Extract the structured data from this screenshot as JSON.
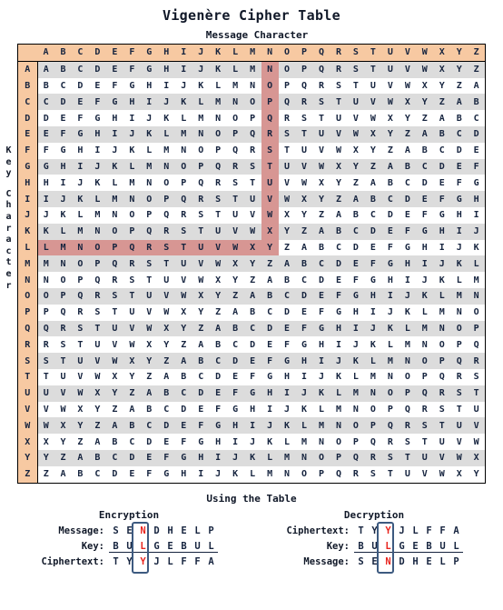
{
  "title": "Vigenère Cipher Table",
  "labels": {
    "message_character": "Message Character",
    "key_character": "Key Character",
    "using_the_table": "Using the Table"
  },
  "colors": {
    "header_peach": "#f7c9a2",
    "highlight_salmon": "#d79693",
    "stripe_gray": "#dcdcdc",
    "stripe_white": "#ffffff",
    "mark_red": "#e8251f",
    "box_blue": "#3d5a80",
    "text_navy": "#16243f"
  },
  "table": {
    "alphabet": [
      "A",
      "B",
      "C",
      "D",
      "E",
      "F",
      "G",
      "H",
      "I",
      "J",
      "K",
      "L",
      "M",
      "N",
      "O",
      "P",
      "Q",
      "R",
      "S",
      "T",
      "U",
      "V",
      "W",
      "X",
      "Y",
      "Z"
    ],
    "highlight_row": "L",
    "highlight_col": "N",
    "intersection_value": "Y",
    "rows": [
      {
        "key": "A",
        "cells": [
          "A",
          "B",
          "C",
          "D",
          "E",
          "F",
          "G",
          "H",
          "I",
          "J",
          "K",
          "L",
          "M",
          "N",
          "O",
          "P",
          "Q",
          "R",
          "S",
          "T",
          "U",
          "V",
          "W",
          "X",
          "Y",
          "Z"
        ]
      },
      {
        "key": "B",
        "cells": [
          "B",
          "C",
          "D",
          "E",
          "F",
          "G",
          "H",
          "I",
          "J",
          "K",
          "L",
          "M",
          "N",
          "O",
          "P",
          "Q",
          "R",
          "S",
          "T",
          "U",
          "V",
          "W",
          "X",
          "Y",
          "Z",
          "A"
        ]
      },
      {
        "key": "C",
        "cells": [
          "C",
          "D",
          "E",
          "F",
          "G",
          "H",
          "I",
          "J",
          "K",
          "L",
          "M",
          "N",
          "O",
          "P",
          "Q",
          "R",
          "S",
          "T",
          "U",
          "V",
          "W",
          "X",
          "Y",
          "Z",
          "A",
          "B"
        ]
      },
      {
        "key": "D",
        "cells": [
          "D",
          "E",
          "F",
          "G",
          "H",
          "I",
          "J",
          "K",
          "L",
          "M",
          "N",
          "O",
          "P",
          "Q",
          "R",
          "S",
          "T",
          "U",
          "V",
          "W",
          "X",
          "Y",
          "Z",
          "A",
          "B",
          "C"
        ]
      },
      {
        "key": "E",
        "cells": [
          "E",
          "F",
          "G",
          "H",
          "I",
          "J",
          "K",
          "L",
          "M",
          "N",
          "O",
          "P",
          "Q",
          "R",
          "S",
          "T",
          "U",
          "V",
          "W",
          "X",
          "Y",
          "Z",
          "A",
          "B",
          "C",
          "D"
        ]
      },
      {
        "key": "F",
        "cells": [
          "F",
          "G",
          "H",
          "I",
          "J",
          "K",
          "L",
          "M",
          "N",
          "O",
          "P",
          "Q",
          "R",
          "S",
          "T",
          "U",
          "V",
          "W",
          "X",
          "Y",
          "Z",
          "A",
          "B",
          "C",
          "D",
          "E"
        ]
      },
      {
        "key": "G",
        "cells": [
          "G",
          "H",
          "I",
          "J",
          "K",
          "L",
          "M",
          "N",
          "O",
          "P",
          "Q",
          "R",
          "S",
          "T",
          "U",
          "V",
          "W",
          "X",
          "Y",
          "Z",
          "A",
          "B",
          "C",
          "D",
          "E",
          "F"
        ]
      },
      {
        "key": "H",
        "cells": [
          "H",
          "I",
          "J",
          "K",
          "L",
          "M",
          "N",
          "O",
          "P",
          "Q",
          "R",
          "S",
          "T",
          "U",
          "V",
          "W",
          "X",
          "Y",
          "Z",
          "A",
          "B",
          "C",
          "D",
          "E",
          "F",
          "G"
        ]
      },
      {
        "key": "I",
        "cells": [
          "I",
          "J",
          "K",
          "L",
          "M",
          "N",
          "O",
          "P",
          "Q",
          "R",
          "S",
          "T",
          "U",
          "V",
          "W",
          "X",
          "Y",
          "Z",
          "A",
          "B",
          "C",
          "D",
          "E",
          "F",
          "G",
          "H"
        ]
      },
      {
        "key": "J",
        "cells": [
          "J",
          "K",
          "L",
          "M",
          "N",
          "O",
          "P",
          "Q",
          "R",
          "S",
          "T",
          "U",
          "V",
          "W",
          "X",
          "Y",
          "Z",
          "A",
          "B",
          "C",
          "D",
          "E",
          "F",
          "G",
          "H",
          "I"
        ]
      },
      {
        "key": "K",
        "cells": [
          "K",
          "L",
          "M",
          "N",
          "O",
          "P",
          "Q",
          "R",
          "S",
          "T",
          "U",
          "V",
          "W",
          "X",
          "Y",
          "Z",
          "A",
          "B",
          "C",
          "D",
          "E",
          "F",
          "G",
          "H",
          "I",
          "J"
        ]
      },
      {
        "key": "L",
        "cells": [
          "L",
          "M",
          "N",
          "O",
          "P",
          "Q",
          "R",
          "S",
          "T",
          "U",
          "V",
          "W",
          "X",
          "Y",
          "Z",
          "A",
          "B",
          "C",
          "D",
          "E",
          "F",
          "G",
          "H",
          "I",
          "J",
          "K"
        ]
      },
      {
        "key": "M",
        "cells": [
          "M",
          "N",
          "O",
          "P",
          "Q",
          "R",
          "S",
          "T",
          "U",
          "V",
          "W",
          "X",
          "Y",
          "Z",
          "A",
          "B",
          "C",
          "D",
          "E",
          "F",
          "G",
          "H",
          "I",
          "J",
          "K",
          "L"
        ]
      },
      {
        "key": "N",
        "cells": [
          "N",
          "O",
          "P",
          "Q",
          "R",
          "S",
          "T",
          "U",
          "V",
          "W",
          "X",
          "Y",
          "Z",
          "A",
          "B",
          "C",
          "D",
          "E",
          "F",
          "G",
          "H",
          "I",
          "J",
          "K",
          "L",
          "M"
        ]
      },
      {
        "key": "O",
        "cells": [
          "O",
          "P",
          "Q",
          "R",
          "S",
          "T",
          "U",
          "V",
          "W",
          "X",
          "Y",
          "Z",
          "A",
          "B",
          "C",
          "D",
          "E",
          "F",
          "G",
          "H",
          "I",
          "J",
          "K",
          "L",
          "M",
          "N"
        ]
      },
      {
        "key": "P",
        "cells": [
          "P",
          "Q",
          "R",
          "S",
          "T",
          "U",
          "V",
          "W",
          "X",
          "Y",
          "Z",
          "A",
          "B",
          "C",
          "D",
          "E",
          "F",
          "G",
          "H",
          "I",
          "J",
          "K",
          "L",
          "M",
          "N",
          "O"
        ]
      },
      {
        "key": "Q",
        "cells": [
          "Q",
          "R",
          "S",
          "T",
          "U",
          "V",
          "W",
          "X",
          "Y",
          "Z",
          "A",
          "B",
          "C",
          "D",
          "E",
          "F",
          "G",
          "H",
          "I",
          "J",
          "K",
          "L",
          "M",
          "N",
          "O",
          "P"
        ]
      },
      {
        "key": "R",
        "cells": [
          "R",
          "S",
          "T",
          "U",
          "V",
          "W",
          "X",
          "Y",
          "Z",
          "A",
          "B",
          "C",
          "D",
          "E",
          "F",
          "G",
          "H",
          "I",
          "J",
          "K",
          "L",
          "M",
          "N",
          "O",
          "P",
          "Q"
        ]
      },
      {
        "key": "S",
        "cells": [
          "S",
          "T",
          "U",
          "V",
          "W",
          "X",
          "Y",
          "Z",
          "A",
          "B",
          "C",
          "D",
          "E",
          "F",
          "G",
          "H",
          "I",
          "J",
          "K",
          "L",
          "M",
          "N",
          "O",
          "P",
          "Q",
          "R"
        ]
      },
      {
        "key": "T",
        "cells": [
          "T",
          "U",
          "V",
          "W",
          "X",
          "Y",
          "Z",
          "A",
          "B",
          "C",
          "D",
          "E",
          "F",
          "G",
          "H",
          "I",
          "J",
          "K",
          "L",
          "M",
          "N",
          "O",
          "P",
          "Q",
          "R",
          "S"
        ]
      },
      {
        "key": "U",
        "cells": [
          "U",
          "V",
          "W",
          "X",
          "Y",
          "Z",
          "A",
          "B",
          "C",
          "D",
          "E",
          "F",
          "G",
          "H",
          "I",
          "J",
          "K",
          "L",
          "M",
          "N",
          "O",
          "P",
          "Q",
          "R",
          "S",
          "T"
        ]
      },
      {
        "key": "V",
        "cells": [
          "V",
          "W",
          "X",
          "Y",
          "Z",
          "A",
          "B",
          "C",
          "D",
          "E",
          "F",
          "G",
          "H",
          "I",
          "J",
          "K",
          "L",
          "M",
          "N",
          "O",
          "P",
          "Q",
          "R",
          "S",
          "T",
          "U"
        ]
      },
      {
        "key": "W",
        "cells": [
          "W",
          "X",
          "Y",
          "Z",
          "A",
          "B",
          "C",
          "D",
          "E",
          "F",
          "G",
          "H",
          "I",
          "J",
          "K",
          "L",
          "M",
          "N",
          "O",
          "P",
          "Q",
          "R",
          "S",
          "T",
          "U",
          "V"
        ]
      },
      {
        "key": "X",
        "cells": [
          "X",
          "Y",
          "Z",
          "A",
          "B",
          "C",
          "D",
          "E",
          "F",
          "G",
          "H",
          "I",
          "J",
          "K",
          "L",
          "M",
          "N",
          "O",
          "P",
          "Q",
          "R",
          "S",
          "T",
          "U",
          "V",
          "W"
        ]
      },
      {
        "key": "Y",
        "cells": [
          "Y",
          "Z",
          "A",
          "B",
          "C",
          "D",
          "E",
          "F",
          "G",
          "H",
          "I",
          "J",
          "K",
          "L",
          "M",
          "N",
          "O",
          "P",
          "Q",
          "R",
          "S",
          "T",
          "U",
          "V",
          "W",
          "X"
        ]
      },
      {
        "key": "Z",
        "cells": [
          "Z",
          "A",
          "B",
          "C",
          "D",
          "E",
          "F",
          "G",
          "H",
          "I",
          "J",
          "K",
          "L",
          "M",
          "N",
          "O",
          "P",
          "Q",
          "R",
          "S",
          "T",
          "U",
          "V",
          "W",
          "X",
          "Y"
        ]
      }
    ]
  },
  "examples": {
    "encryption": {
      "heading": "Encryption",
      "rows": [
        {
          "label": "Message:",
          "letters": [
            "S",
            "E",
            "N",
            "D",
            "H",
            "E",
            "L",
            "P"
          ],
          "mark_index": 2,
          "underline": false
        },
        {
          "label": "Key:",
          "letters": [
            "B",
            "U",
            "L",
            "G",
            "E",
            "B",
            "U",
            "L"
          ],
          "mark_index": 2,
          "underline": true
        },
        {
          "label": "Ciphertext:",
          "letters": [
            "T",
            "Y",
            "Y",
            "J",
            "L",
            "F",
            "F",
            "A"
          ],
          "mark_index": 2,
          "underline": false
        }
      ]
    },
    "decryption": {
      "heading": "Decryption",
      "rows": [
        {
          "label": "Ciphertext:",
          "letters": [
            "T",
            "Y",
            "Y",
            "J",
            "L",
            "F",
            "F",
            "A"
          ],
          "mark_index": 2,
          "underline": false
        },
        {
          "label": "Key:",
          "letters": [
            "B",
            "U",
            "L",
            "G",
            "E",
            "B",
            "U",
            "L"
          ],
          "mark_index": 2,
          "underline": true
        },
        {
          "label": "Message:",
          "letters": [
            "S",
            "E",
            "N",
            "D",
            "H",
            "E",
            "L",
            "P"
          ],
          "mark_index": 2,
          "underline": false
        }
      ]
    }
  }
}
